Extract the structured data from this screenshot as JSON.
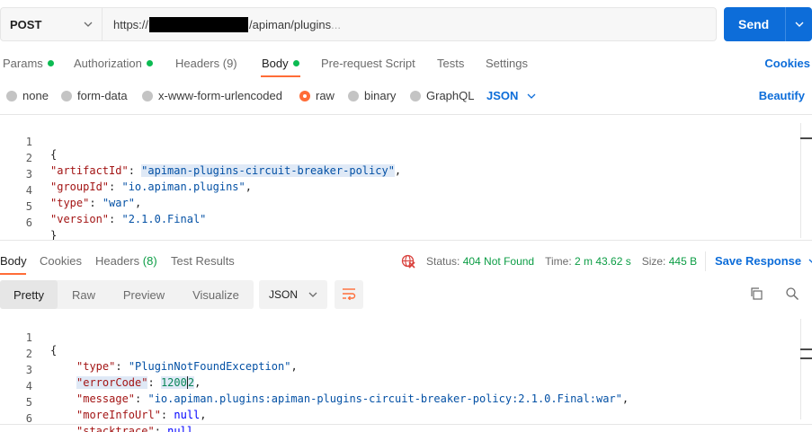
{
  "request": {
    "method": "POST",
    "url_prefix": "https://",
    "url_suffix": "/apiman/plugins",
    "url_ellipsis": "...",
    "send_label": "Send"
  },
  "tabs": [
    {
      "label": "Params",
      "dot": true
    },
    {
      "label": "Authorization",
      "dot": true
    },
    {
      "label": "Headers (9)",
      "dot": false
    },
    {
      "label": "Body",
      "dot": true
    },
    {
      "label": "Pre-request Script",
      "dot": false
    },
    {
      "label": "Tests",
      "dot": false
    },
    {
      "label": "Settings",
      "dot": false
    }
  ],
  "cookies_link": "Cookies",
  "body_types": [
    "none",
    "form-data",
    "x-www-form-urlencoded",
    "raw",
    "binary",
    "GraphQL"
  ],
  "body_format": "JSON",
  "beautify_label": "Beautify",
  "request_body": {
    "line_numbers": [
      "1",
      "2",
      "3",
      "4",
      "5",
      "6"
    ],
    "open_brace": "{",
    "close_brace": "}",
    "fields": [
      {
        "key": "\"artifactId\"",
        "value": "\"apiman-plugins-circuit-breaker-policy\""
      },
      {
        "key": "\"groupId\"",
        "value": "\"io.apiman.plugins\""
      },
      {
        "key": "\"type\"",
        "value": "\"war\""
      },
      {
        "key": "\"version\"",
        "value": "\"2.1.0.Final\""
      }
    ]
  },
  "response_tabs": {
    "body": "Body",
    "cookies": "Cookies",
    "headers_label": "Headers",
    "headers_count": "(8)",
    "test_results": "Test Results"
  },
  "response_status": {
    "status_label": "Status:",
    "status_value": "404 Not Found",
    "time_label": "Time:",
    "time_value": "2 m 43.62 s",
    "size_label": "Size:",
    "size_value": "445 B",
    "save_response": "Save Response"
  },
  "views": [
    "Pretty",
    "Raw",
    "Preview",
    "Visualize"
  ],
  "response_format": "JSON",
  "response_body": {
    "line_numbers": [
      "1",
      "2",
      "3",
      "4",
      "5",
      "6"
    ],
    "open_brace": "{",
    "type_key": "\"type\"",
    "type_value": "\"PluginNotFoundException\"",
    "error_key": "\"errorCode\"",
    "error_value_a": "1200",
    "error_value_b": "2",
    "message_key": "\"message\"",
    "message_value": "\"io.apiman.plugins:apiman-plugins-circuit-breaker-policy:2.1.0.Final:war\"",
    "more_key": "\"moreInfoUrl\"",
    "more_value": "null",
    "stack_key": "\"stacktrace\"",
    "stack_value": "null"
  },
  "colors": {
    "accent": "#ff6c37",
    "primary": "#0d6dd9",
    "success": "#0c9d45",
    "status_dot": "#0cbb52"
  }
}
